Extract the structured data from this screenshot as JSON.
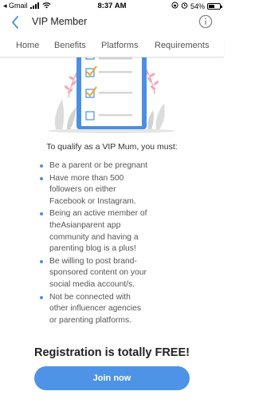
{
  "status_bar": {
    "carrier": "◂ Gmail",
    "time": "8:37 AM",
    "battery_text": "54%",
    "battery_level": 0.54
  },
  "header": {
    "title": "VIP Member",
    "back_icon": "chevron-left-icon",
    "info_icon": "info-icon"
  },
  "tabs": [
    {
      "label": "Home"
    },
    {
      "label": "Benefits"
    },
    {
      "label": "Platforms"
    },
    {
      "label": "Requirements"
    }
  ],
  "content": {
    "qualify_title": "To qualify as a VIP Mum, you must:",
    "requirements": [
      {
        "line1": "Be a parent or be pregnant"
      },
      {
        "line1": "Have more than 500",
        "line2": "followers on either",
        "line3": "Facebook or Instagram."
      },
      {
        "line1": "Being an active member of",
        "line2": "theAsianparent app",
        "line3": "community and having a",
        "line4": "parenting blog is a plus!"
      },
      {
        "line1": "Be willing to post brand-",
        "line2": "sponsored content on your",
        "line3": "social media account/s."
      },
      {
        "line1": "Not be connected with",
        "line2": "other influencer agencies",
        "line3": "or parenting platforms."
      }
    ],
    "free_text": "Registration is totally FREE!",
    "join_label": "Join now"
  },
  "colors": {
    "accent": "#4a90e2",
    "bullet": "#4a90e2",
    "button": "#4e93e6",
    "check_orange": "#f5a623",
    "leaf_pink": "#f2a7b4",
    "clipboard_blue": "#4a90e2"
  }
}
